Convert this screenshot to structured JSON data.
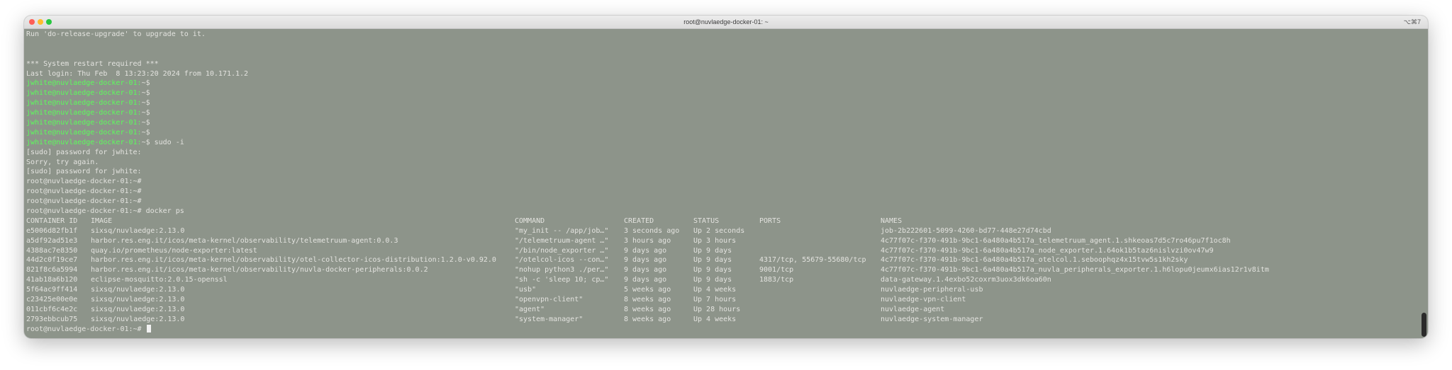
{
  "window": {
    "title": "root@nuvlaedge-docker-01: ~",
    "shortcut": "⌥⌘7"
  },
  "terminal": {
    "pre_lines": [
      {
        "kind": "text",
        "text": "Run 'do-release-upgrade' to upgrade to it."
      },
      {
        "kind": "text",
        "text": ""
      },
      {
        "kind": "text",
        "text": ""
      },
      {
        "kind": "text",
        "text": "*** System restart required ***"
      },
      {
        "kind": "text",
        "text": "Last login: Thu Feb  8 13:23:20 2024 from 10.171.1.2"
      },
      {
        "kind": "prompt",
        "prompt": "jwhite@nuvlaedge-docker-01:",
        "rest": "~$"
      },
      {
        "kind": "prompt",
        "prompt": "jwhite@nuvlaedge-docker-01:",
        "rest": "~$"
      },
      {
        "kind": "prompt",
        "prompt": "jwhite@nuvlaedge-docker-01:",
        "rest": "~$"
      },
      {
        "kind": "prompt",
        "prompt": "jwhite@nuvlaedge-docker-01:",
        "rest": "~$"
      },
      {
        "kind": "prompt",
        "prompt": "jwhite@nuvlaedge-docker-01:",
        "rest": "~$"
      },
      {
        "kind": "prompt",
        "prompt": "jwhite@nuvlaedge-docker-01:",
        "rest": "~$"
      },
      {
        "kind": "prompt",
        "prompt": "jwhite@nuvlaedge-docker-01:",
        "rest": "~$ sudo -i"
      },
      {
        "kind": "text",
        "text": "[sudo] password for jwhite:"
      },
      {
        "kind": "text",
        "text": "Sorry, try again."
      },
      {
        "kind": "text",
        "text": "[sudo] password for jwhite:"
      },
      {
        "kind": "text",
        "text": "root@nuvlaedge-docker-01:~#"
      },
      {
        "kind": "text",
        "text": "root@nuvlaedge-docker-01:~#"
      },
      {
        "kind": "text",
        "text": "root@nuvlaedge-docker-01:~#"
      },
      {
        "kind": "text",
        "text": "root@nuvlaedge-docker-01:~# docker ps"
      }
    ],
    "table": {
      "headers": [
        "CONTAINER ID",
        "IMAGE",
        "COMMAND",
        "CREATED",
        "STATUS",
        "PORTS",
        "NAMES"
      ],
      "rows": [
        [
          "e5006d82fb1f",
          "sixsq/nuvlaedge:2.13.0",
          "\"my_init -- /app/job…\"",
          "3 seconds ago",
          "Up 2 seconds",
          "",
          "job-2b222601-5099-4260-bd77-448e27d74cbd"
        ],
        [
          "a5df92ad51e3",
          "harbor.res.eng.it/icos/meta-kernel/observability/telemetruum-agent:0.0.3",
          "\"/telemetruum-agent …\"",
          "3 hours ago",
          "Up 3 hours",
          "",
          "4c77f07c-f370-491b-9bc1-6a480a4b517a_telemetruum_agent.1.shkeoas7d5c7ro46pu7f1oc8h"
        ],
        [
          "4388ac7e8350",
          "quay.io/prometheus/node-exporter:latest",
          "\"/bin/node_exporter …\"",
          "9 days ago",
          "Up 9 days",
          "",
          "4c77f07c-f370-491b-9bc1-6a480a4b517a_node_exporter.1.64ok1b5taz6nislvzi0ov47w9"
        ],
        [
          "44d2c0f19ce7",
          "harbor.res.eng.it/icos/meta-kernel/observability/otel-collector-icos-distribution:1.2.0-v0.92.0",
          "\"/otelcol-icos --con…\"",
          "9 days ago",
          "Up 9 days",
          "4317/tcp, 55679-55680/tcp",
          "4c77f07c-f370-491b-9bc1-6a480a4b517a_otelcol.1.seboophqz4x15tvw5s1kh2sky"
        ],
        [
          "821f8c6a5994",
          "harbor.res.eng.it/icos/meta-kernel/observability/nuvla-docker-peripherals:0.0.2",
          "\"nohup python3 ./per…\"",
          "9 days ago",
          "Up 9 days",
          "9001/tcp",
          "4c77f07c-f370-491b-9bc1-6a480a4b517a_nuvla_peripherals_exporter.1.h6lopu0jeumx6ias12r1v8itm"
        ],
        [
          "41ab18a6b120",
          "eclipse-mosquitto:2.0.15-openssl",
          "\"sh -c 'sleep 10; cp…\"",
          "9 days ago",
          "Up 9 days",
          "1883/tcp",
          "data-gateway.1.4exbo52coxrm3uox3dk6oa60n"
        ],
        [
          "5f64ac9ff414",
          "sixsq/nuvlaedge:2.13.0",
          "\"usb\"",
          "5 weeks ago",
          "Up 4 weeks",
          "",
          "nuvlaedge-peripheral-usb"
        ],
        [
          "c23425e00e0e",
          "sixsq/nuvlaedge:2.13.0",
          "\"openvpn-client\"",
          "8 weeks ago",
          "Up 7 hours",
          "",
          "nuvlaedge-vpn-client"
        ],
        [
          "011cbf6c4e2c",
          "sixsq/nuvlaedge:2.13.0",
          "\"agent\"",
          "8 weeks ago",
          "Up 28 hours",
          "",
          "nuvlaedge-agent"
        ],
        [
          "2793ebbcub75",
          "sixsq/nuvlaedge:2.13.0",
          "\"system-manager\"",
          "8 weeks ago",
          "Up 4 weeks",
          "",
          "nuvlaedge-system-manager"
        ]
      ]
    },
    "final_prompt": "root@nuvlaedge-docker-01:~#"
  },
  "colors": {
    "terminal_bg": "#8d948a",
    "text": "#e3e3df",
    "prompt_green": "#5dfa5d"
  }
}
